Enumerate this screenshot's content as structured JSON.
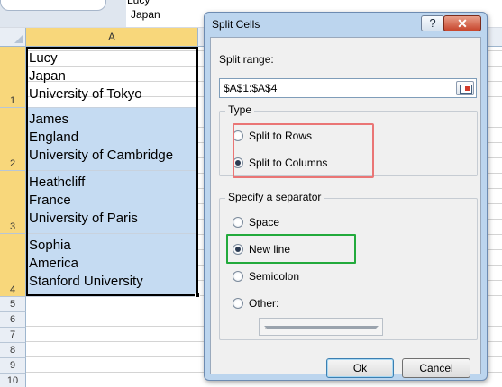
{
  "formula_bar": {
    "line1": "Lucy",
    "line2": "Japan"
  },
  "sheet": {
    "column_header": "A",
    "rows": [
      {
        "num": "1",
        "lines": [
          "Lucy",
          "Japan",
          "University of Tokyo"
        ]
      },
      {
        "num": "2",
        "lines": [
          "James",
          "England",
          "University of Cambridge"
        ]
      },
      {
        "num": "3",
        "lines": [
          "Heathcliff",
          "France",
          "University of Paris"
        ]
      },
      {
        "num": "4",
        "lines": [
          "Sophia",
          "America",
          "Stanford University"
        ]
      }
    ],
    "empty_rows": [
      "5",
      "6",
      "7",
      "8",
      "9",
      "10"
    ]
  },
  "dialog": {
    "title": "Split Cells",
    "help_label": "?",
    "close_label": "✕",
    "split_range_label": "Split range:",
    "split_range_value": "$A$1:$A$4",
    "type_group": {
      "title": "Type",
      "options": [
        {
          "label": "Split to Rows",
          "checked": false
        },
        {
          "label": "Split to Columns",
          "checked": true
        }
      ]
    },
    "separator_group": {
      "title": "Specify a separator",
      "options": [
        {
          "label": "Space",
          "checked": false
        },
        {
          "label": "New line",
          "checked": true
        },
        {
          "label": "Semicolon",
          "checked": false
        },
        {
          "label": "Other:",
          "checked": false
        }
      ],
      "other_value": "."
    },
    "ok_label": "Ok",
    "cancel_label": "Cancel"
  },
  "colors": {
    "selection": "#c5dbf2",
    "header_highlight": "#f8d77b",
    "dialog_frame": "#bcd5ee",
    "highlight_red": "#ea7575",
    "highlight_green": "#22aa3c"
  }
}
